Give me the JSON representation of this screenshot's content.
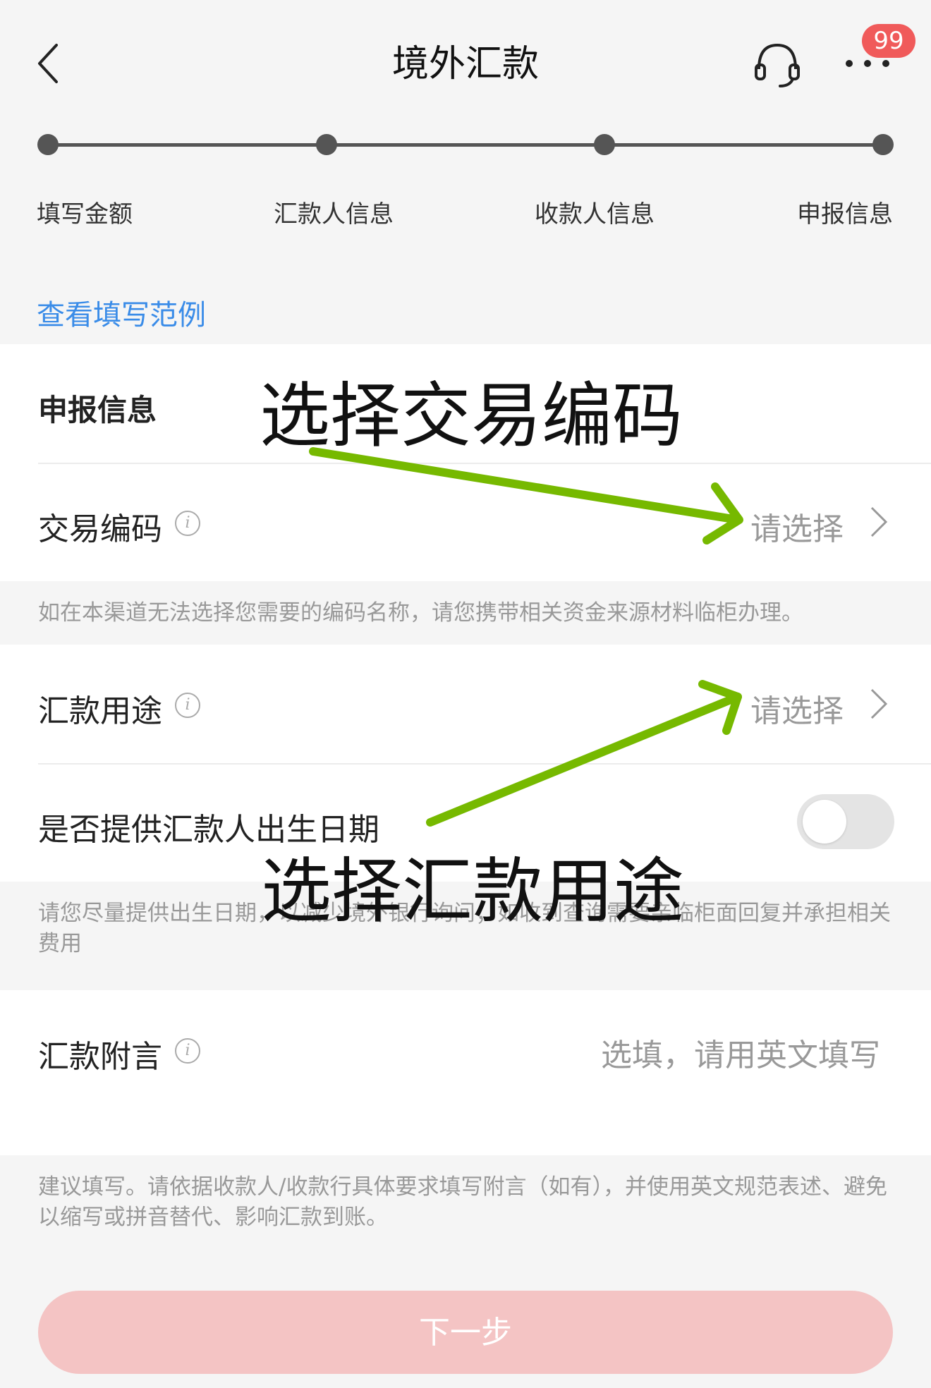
{
  "header": {
    "title": "境外汇款",
    "badge_count": "99"
  },
  "stepper": {
    "steps": [
      "填写金额",
      "汇款人信息",
      "收款人信息",
      "申报信息"
    ]
  },
  "example_link": "查看填写范例",
  "declaration": {
    "section_title": "申报信息",
    "transaction_code": {
      "label": "交易编码",
      "value": "请选择"
    },
    "transaction_hint": "如在本渠道无法选择您需要的编码名称，请您携带相关资金来源材料临柜办理。",
    "purpose": {
      "label": "汇款用途",
      "value": "请选择"
    },
    "birthdate": {
      "label": "是否提供汇款人出生日期",
      "enabled": false
    },
    "birthdate_hint": "请您尽量提供出生日期，以减少境外银行询问；如收到查询需要亲临柜面回复并承担相关费用",
    "remark": {
      "label": "汇款附言",
      "placeholder": "选填，请用英文填写"
    },
    "remark_hint": "建议填写。请依据收款人/收款行具体要求填写附言（如有），并使用英文规范表述、避免以缩写或拼音替代、影响汇款到账。"
  },
  "next_button": "下一步",
  "annotations": {
    "select_code": "选择交易编码",
    "select_purpose": "选择汇款用途",
    "arrow_color": "#76b900"
  },
  "colors": {
    "link": "#3a8ce8",
    "badge": "#f05a5a",
    "button_disabled": "#f4c4c4"
  }
}
